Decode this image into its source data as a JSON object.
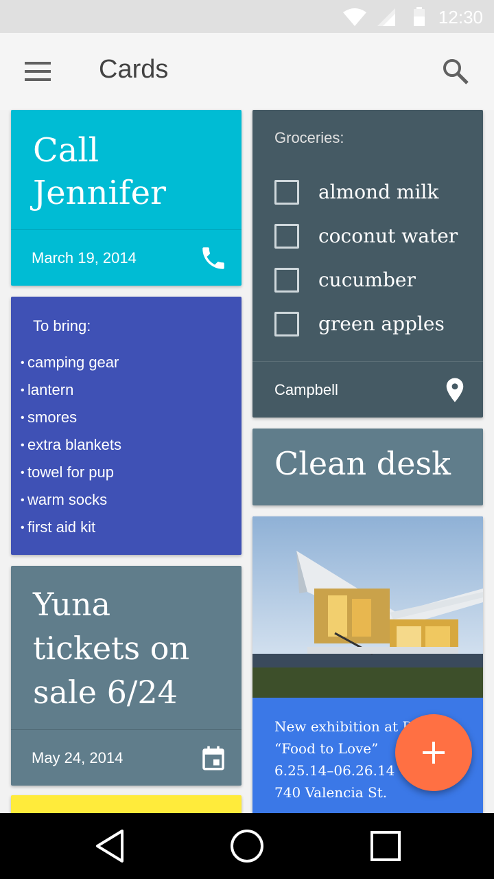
{
  "status_bar": {
    "time": "12:30",
    "icons": [
      "wifi-icon",
      "signal-icon",
      "battery-icon"
    ]
  },
  "app_bar": {
    "title": "Cards",
    "icons": [
      "menu-icon",
      "search-icon"
    ]
  },
  "cards": {
    "call": {
      "title_line1": "Call",
      "title_line2": "Jennifer",
      "date": "March 19, 2014",
      "icon": "phone-icon",
      "color": "#00bcd4"
    },
    "bring": {
      "title": "To bring:",
      "items": [
        "camping gear",
        "lantern",
        "smores",
        "extra blankets",
        "towel for pup",
        "warm socks",
        "first aid kit"
      ],
      "color": "#3f51b5"
    },
    "yuna": {
      "title_line1": "Yuna",
      "title_line2": "tickets on",
      "title_line3": "sale 6/24",
      "date": "May 24, 2014",
      "icon": "calendar-icon",
      "color": "#607d8b"
    },
    "groceries": {
      "title": "Groceries:",
      "items": [
        "almond milk",
        "coconut water",
        "cucumber",
        "green apples"
      ],
      "location": "Campbell",
      "icon": "location-pin-icon",
      "color": "#455a64"
    },
    "clean": {
      "title": "Clean desk",
      "color": "#607d8b"
    },
    "exhibition": {
      "line1": "New exhibition at Da",
      "line2": "“Food to Love”",
      "line3": "6.25.14–06.26.14",
      "line4": "740 Valencia St.",
      "color": "#3b78e7"
    },
    "yellow": {
      "color": "#ffeb3b"
    }
  },
  "fab": {
    "icon": "plus-icon",
    "color": "#ff7043"
  },
  "nav_bar": {
    "icons": [
      "back-icon",
      "home-icon",
      "recents-icon"
    ]
  }
}
